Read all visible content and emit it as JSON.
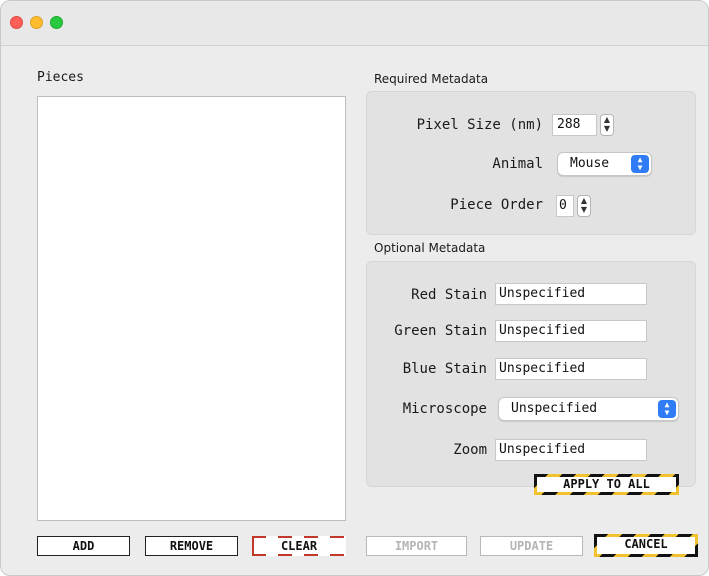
{
  "window": {
    "controls": {
      "close_color": "#fe5f57",
      "minimize_color": "#febc2e",
      "zoom_color": "#28c840"
    }
  },
  "pieces": {
    "label": "Pieces",
    "items": []
  },
  "required": {
    "title": "Required Metadata",
    "pixel_size": {
      "label": "Pixel Size (nm)",
      "value": "288"
    },
    "animal": {
      "label": "Animal",
      "value": "Mouse"
    },
    "piece_order": {
      "label": "Piece Order",
      "value": "0"
    }
  },
  "optional": {
    "title": "Optional Metadata",
    "red_stain": {
      "label": "Red Stain",
      "value": "Unspecified"
    },
    "green_stain": {
      "label": "Green Stain",
      "value": "Unspecified"
    },
    "blue_stain": {
      "label": "Blue Stain",
      "value": "Unspecified"
    },
    "microscope": {
      "label": "Microscope",
      "value": "Unspecified"
    },
    "zoom": {
      "label": "Zoom",
      "value": "Unspecified"
    },
    "apply_all_label": "APPLY TO ALL"
  },
  "buttons": {
    "add": "ADD",
    "remove": "REMOVE",
    "clear": "CLEAR",
    "import": "IMPORT",
    "update": "UPDATE",
    "cancel": "CANCEL"
  },
  "colors": {
    "accent": "#2f7cf6",
    "hazard_yellow": "#f2c12e",
    "clear_red": "#c0392b"
  }
}
